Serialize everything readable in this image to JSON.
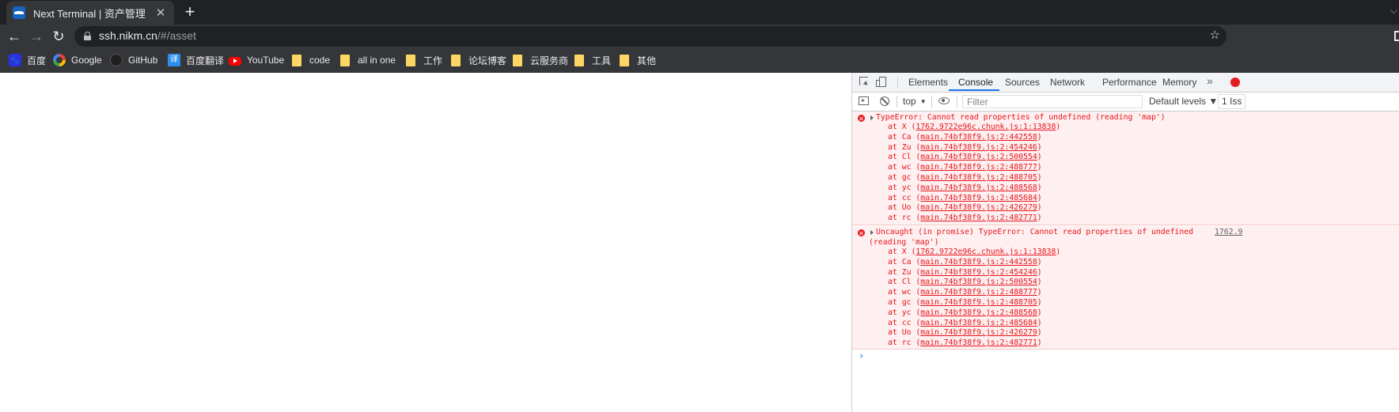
{
  "browser": {
    "tab": {
      "title": "Next Terminal | 资产管理",
      "close": "✕"
    },
    "new_tab": "+",
    "tabstrip_chevron": "⌵",
    "nav": {
      "back": "←",
      "forward": "→",
      "reload": "↻"
    },
    "address": {
      "host": "ssh.nikm.cn",
      "path": "/#/asset"
    },
    "star": "☆",
    "bookmarks": [
      {
        "label": "百度",
        "icon": "baidu-icon"
      },
      {
        "label": "Google",
        "icon": "google-icon"
      },
      {
        "label": "GitHub",
        "icon": "github-icon"
      },
      {
        "label": "百度翻译",
        "icon": "baidu-translate-icon"
      },
      {
        "label": "YouTube",
        "icon": "youtube-icon"
      },
      {
        "label": "code",
        "icon": "folder-icon"
      },
      {
        "label": "all in one",
        "icon": "folder-icon"
      },
      {
        "label": "工作",
        "icon": "folder-icon"
      },
      {
        "label": "论坛博客",
        "icon": "folder-icon"
      },
      {
        "label": "云服务商",
        "icon": "folder-icon"
      },
      {
        "label": "工具",
        "icon": "folder-icon"
      },
      {
        "label": "其他",
        "icon": "folder-icon"
      }
    ]
  },
  "devtools": {
    "tabs": [
      "Elements",
      "Console",
      "Sources",
      "Network",
      "Performance",
      "Memory"
    ],
    "active_tab": "Console",
    "more": "»",
    "console_bar": {
      "context": "top",
      "caret": "▼",
      "filter_placeholder": "Filter",
      "levels": "Default levels ▼",
      "issues": "1 Iss"
    },
    "messages": [
      {
        "text": "TypeError: Cannot read properties of undefined (reading 'map')",
        "source": "",
        "stack": [
          [
            "at X (",
            "1762.9722e96c.chunk.js:1:13838",
            ")"
          ],
          [
            "at Ca (",
            "main.74bf38f9.js:2:442558",
            ")"
          ],
          [
            "at Zu (",
            "main.74bf38f9.js:2:454246",
            ")"
          ],
          [
            "at Cl (",
            "main.74bf38f9.js:2:500554",
            ")"
          ],
          [
            "at wc (",
            "main.74bf38f9.js:2:488777",
            ")"
          ],
          [
            "at gc (",
            "main.74bf38f9.js:2:488705",
            ")"
          ],
          [
            "at yc (",
            "main.74bf38f9.js:2:488568",
            ")"
          ],
          [
            "at cc (",
            "main.74bf38f9.js:2:485684",
            ")"
          ],
          [
            "at Uo (",
            "main.74bf38f9.js:2:426279",
            ")"
          ],
          [
            "at rc (",
            "main.74bf38f9.js:2:482771",
            ")"
          ]
        ]
      },
      {
        "text": "Uncaught (in promise) TypeError: Cannot read properties of undefined",
        "text2": "(reading 'map')",
        "source": "1762.9",
        "stack": [
          [
            "at X (",
            "1762.9722e96c.chunk.js:1:13838",
            ")"
          ],
          [
            "at Ca (",
            "main.74bf38f9.js:2:442558",
            ")"
          ],
          [
            "at Zu (",
            "main.74bf38f9.js:2:454246",
            ")"
          ],
          [
            "at Cl (",
            "main.74bf38f9.js:2:500554",
            ")"
          ],
          [
            "at wc (",
            "main.74bf38f9.js:2:488777",
            ")"
          ],
          [
            "at gc (",
            "main.74bf38f9.js:2:488705",
            ")"
          ],
          [
            "at yc (",
            "main.74bf38f9.js:2:488568",
            ")"
          ],
          [
            "at cc (",
            "main.74bf38f9.js:2:485684",
            ")"
          ],
          [
            "at Uo (",
            "main.74bf38f9.js:2:426279",
            ")"
          ],
          [
            "at rc (",
            "main.74bf38f9.js:2:482771",
            ")"
          ]
        ]
      }
    ],
    "prompt": "›"
  }
}
